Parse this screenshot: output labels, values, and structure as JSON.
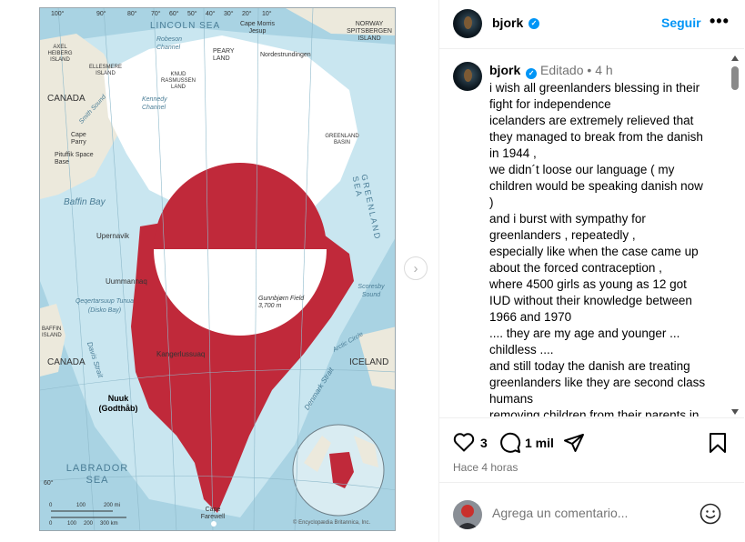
{
  "post": {
    "username": "bjork",
    "follow_label": "Seguir",
    "more_label": "•••",
    "verified_mark": "✓"
  },
  "caption": {
    "username": "bjork",
    "edited_label": "Editado",
    "separator": "•",
    "age": "4 h",
    "lines": [
      "i wish all greenlanders blessing in their",
      "fight for independence",
      "icelanders are extremely relieved that",
      "they managed to break from the danish",
      "in 1944 ,",
      "we didn´t loose our language ( my",
      "children would be speaking danish now",
      ")",
      "and i burst with sympathy for",
      "greenlanders , repeatedly ,",
      "especially like when the case came up",
      "about the forced contraception ,",
      "where 4500 girls as young as 12 got",
      "IUD without their knowledge between",
      "1966 and 1970",
      " .... they are my age and younger ...",
      "childless ....",
      "and still today the danish are treating",
      "greenlanders like they are second class",
      "humans",
      "removing children from their parents in"
    ]
  },
  "actions": {
    "likes": "3",
    "comments": "1 mil",
    "timestamp": "Hace 4 horas"
  },
  "comment_box": {
    "placeholder": "Agrega un comentario..."
  },
  "map": {
    "lat_labels": [
      "100°",
      "90°",
      "80°",
      "70°",
      "60°",
      "50°",
      "40°",
      "30°",
      "20°",
      "10°"
    ],
    "place_labels": [
      "LINCOLN SEA",
      "Robeson Channel",
      "Cape Morris Jesup",
      "PEARY LAND",
      "Nordestrundingen",
      "NORWAY SPITSBERGEN ISLAND",
      "AXEL HEIBERG ISLAND",
      "ELLESMERE ISLAND",
      "KNUD RASMUSSEN LAND",
      "CANADA",
      "Smith Sound",
      "Kennedy Channel",
      "Cape Parry",
      "Pituffik Space Base",
      "GREENLAND BASIN",
      "GREENLAND SEA",
      "Baffin Bay",
      "Upernavik",
      "Uummannaq",
      "Qeqertarsuup Tunua (Disko Bay)",
      "BAFFIN ISLAND",
      "Gunnbjørn Field 3,700 m",
      "Scoresby Sound",
      "Arctic Circle",
      "Kangerlussuaq",
      "Davis Strait",
      "CANADA",
      "ICELAND",
      "Nuuk (Godthåb)",
      "Denmark Strait",
      "LABRADOR SEA",
      "60°",
      "Cape Farewell",
      "© Encyclopædia Britannica, Inc."
    ],
    "scale_labels": [
      "0",
      "100",
      "200 mi",
      "0",
      "100",
      "200",
      "300 km"
    ],
    "colors": {
      "ocean": "#a9d3e3",
      "shelf": "#c9e6f0",
      "ice": "#ffffff",
      "red": "#c0293a",
      "land": "#ece9dc"
    }
  },
  "colors": {
    "accent": "#0095f6",
    "muted": "#737373",
    "divider": "#efefef"
  }
}
